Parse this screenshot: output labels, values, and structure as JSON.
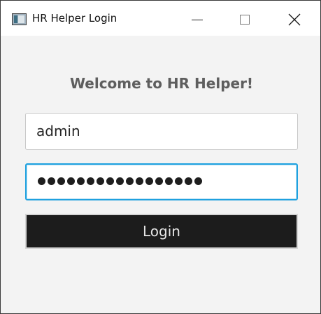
{
  "window": {
    "title": "HR Helper Login",
    "icon": "app-window-icon",
    "controls": {
      "minimize_icon": "minimize-icon",
      "maximize_icon": "maximize-icon",
      "close_icon": "close-icon"
    }
  },
  "login": {
    "welcome": "Welcome to HR Helper!",
    "username_value": "admin",
    "password_masked_length": 17,
    "button_label": "Login"
  },
  "colors": {
    "background": "#f3f3f3",
    "focus_border": "#1fa1df",
    "button_bg": "#1c1c1c",
    "button_text": "#e5e5e5",
    "welcome_text": "#5e5e5e"
  }
}
